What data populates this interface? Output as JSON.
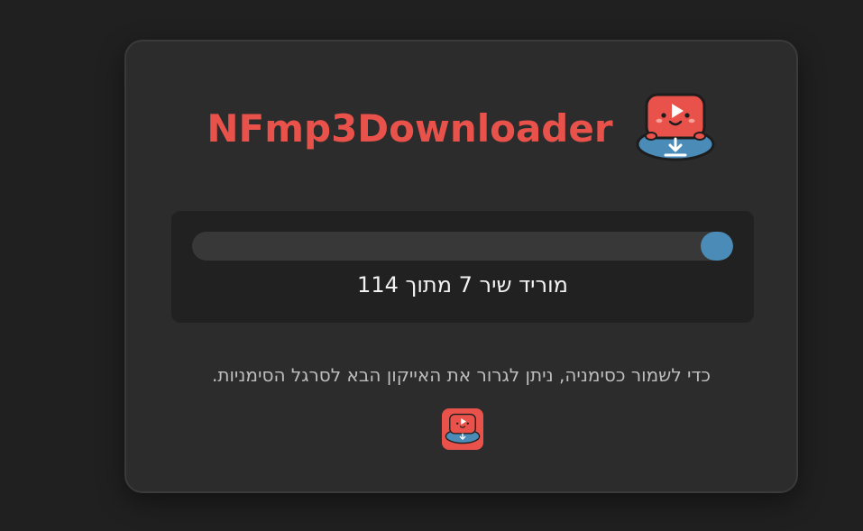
{
  "header": {
    "title": "NFmp3Downloader",
    "logo_icon": "youtube-download-mascot-icon"
  },
  "progress": {
    "fraction": 0.06,
    "status_text": "מוריד שיר 7 מתוך 114",
    "bar_color": "#4a8bb8"
  },
  "bookmark": {
    "hint_text": "כדי לשמור כסימניה, ניתן לגרור את האייקון הבא לסרגל הסימניות.",
    "icon": "youtube-download-mascot-icon"
  },
  "colors": {
    "accent": "#e8524a",
    "background": "#202020",
    "card": "#2c2c2c"
  }
}
